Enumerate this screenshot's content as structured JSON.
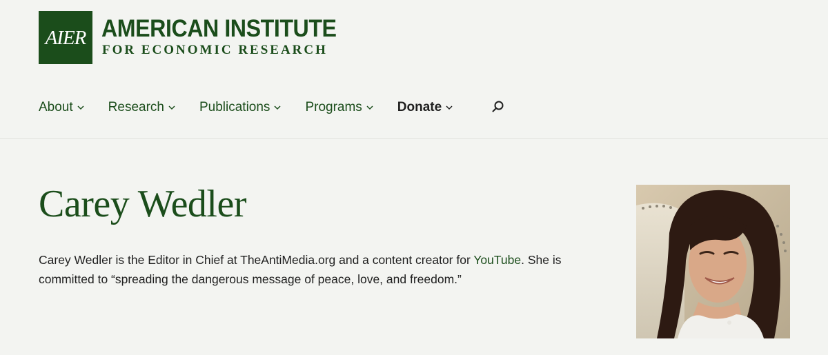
{
  "logo": {
    "mark": "AIER",
    "line1": "AMERICAN INSTITUTE",
    "line2": "FOR ECONOMIC RESEARCH"
  },
  "nav": {
    "items": [
      {
        "label": "About"
      },
      {
        "label": "Research"
      },
      {
        "label": "Publications"
      },
      {
        "label": "Programs"
      },
      {
        "label": "Donate"
      }
    ]
  },
  "colors": {
    "brand_green": "#1b4d1b",
    "background": "#f3f4f1",
    "text": "#1f1f1f"
  },
  "author": {
    "name": "Carey Wedler",
    "bio_part1": "Carey Wedler is the Editor in Chief at TheAntiMedia.org and a content creator for ",
    "bio_link": "YouTube",
    "bio_part2": ". She is committed to “spreading the dangerous message of peace, love, and freedom.”"
  }
}
